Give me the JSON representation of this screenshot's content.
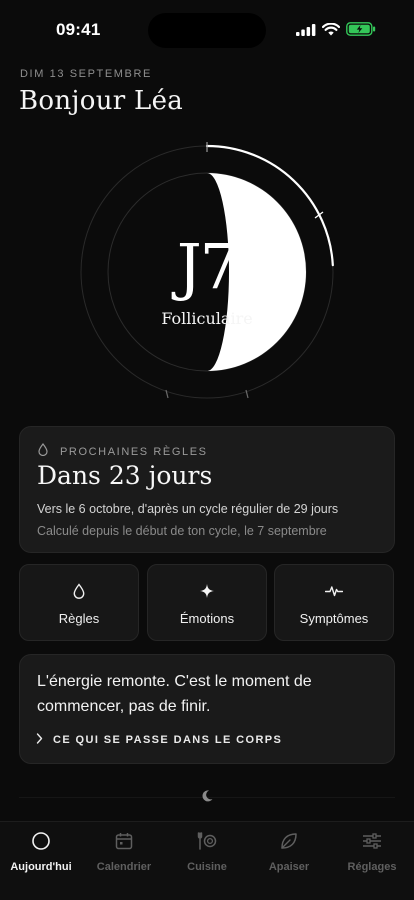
{
  "status_bar": {
    "time": "09:41"
  },
  "header": {
    "date": "DIM 13 SEPTEMBRE",
    "greeting": "Bonjour Léa"
  },
  "cycle": {
    "day_label": "J7",
    "phase": "Folliculaire",
    "current_day": 7,
    "cycle_length": 29
  },
  "next_period": {
    "label": "PROCHAINES RÈGLES",
    "title": "Dans 23 jours",
    "detail": "Vers le 6 octobre, d'après un cycle régulier de 29 jours",
    "calculation": "Calculé depuis le début de ton cycle, le 7 septembre"
  },
  "quick_actions": [
    {
      "label": "Règles",
      "icon": "drop-icon"
    },
    {
      "label": "Émotions",
      "icon": "sparkle-icon"
    },
    {
      "label": "Symptômes",
      "icon": "pulse-icon"
    }
  ],
  "insight": {
    "text": "L'énergie remonte. C'est le moment de commencer, pas de finir.",
    "link_label": "CE QUI SE PASSE DANS LE CORPS"
  },
  "tabs": [
    {
      "label": "Aujourd'hui",
      "icon": "circle-icon",
      "active": true
    },
    {
      "label": "Calendrier",
      "icon": "calendar-icon",
      "active": false
    },
    {
      "label": "Cuisine",
      "icon": "dish-icon",
      "active": false
    },
    {
      "label": "Apaiser",
      "icon": "leaf-icon",
      "active": false
    },
    {
      "label": "Réglages",
      "icon": "sliders-icon",
      "active": false
    }
  ],
  "colors": {
    "background": "#0b0b0b",
    "card": "#1b1b1b",
    "accent": "#ffffff",
    "muted": "#8f8f8f",
    "battery": "#34c759"
  }
}
